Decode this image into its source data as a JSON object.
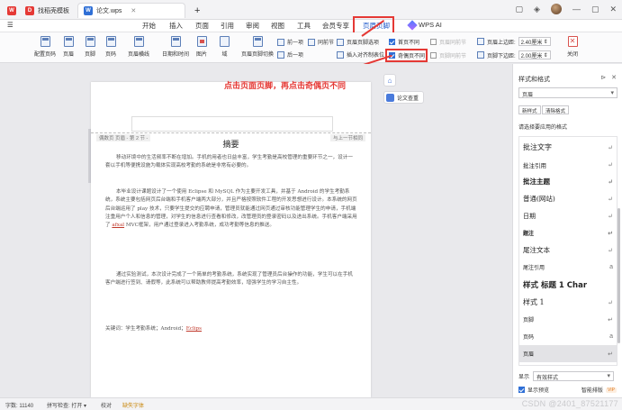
{
  "tabs": [
    {
      "label": "",
      "icon": "wps-logo-icon"
    },
    {
      "label": "找稻壳模板",
      "icon": "docer-icon"
    },
    {
      "label": "论文.wps",
      "icon": "wps-doc-icon"
    }
  ],
  "titlebar_add": "+",
  "titlebar_right": [
    "▢",
    "◈",
    "—",
    "▢",
    "✕"
  ],
  "menu": [
    "☰",
    "开始",
    "插入",
    "页面",
    "引用",
    "审阅",
    "视图",
    "工具",
    "会员专享",
    "页眉页脚",
    "WPS AI"
  ],
  "ribbon": {
    "buttons": [
      "配置页码",
      "页眉",
      "页脚",
      "页码",
      "页眉横线",
      "日期和时间",
      "图片",
      "域",
      "页眉页脚切换"
    ],
    "prev": "前一项",
    "next": "后一项",
    "same_as_prev": "同前节",
    "header_options": "页眉页脚选项",
    "insert_align_tab": "插入对齐制表位",
    "first_page_diff": "首页不同",
    "odd_even_diff": "奇偶页不同",
    "header_same_prev": "页眉同前节",
    "footer_same_prev": "页脚同前节",
    "header_top_label": "页眉上边距:",
    "header_top_value": "2.40厘米",
    "footer_bottom_label": "页脚下边距:",
    "footer_bottom_value": "2.00厘米",
    "close": "关闭"
  },
  "annotation": "点击页面页脚，再点击奇偶页不同",
  "document": {
    "header_left_tag": "偶数页 页眉 - 第 2 节 -",
    "header_right_tag": "与上一节相同",
    "title": "摘要",
    "paragraphs": [
      "移动环境中的生活频率不断在增加。手机的用者也日益丰富，学生考勤是高校管理的重要环节之一，设计一套以手机等便携设施为载体实现高校考勤的系统是非常有必要的。",
      "本毕业设计课题设计了一个使用 Eclipse 和 MySQL 作为主要开发工具，并基于 Android 的学生考勤系统，系统主要包括网页后台端和手机客户端两大部分，并且严格按照软件工程的开发思想进行设计。本系统的网页后台端运用了 play 技术，只要学生提交的应聘申请，管理员就能通过网页通过审核功能管理学生的申请，手机端注重用户个人和信息的管理，对学生的信息进行查看和修改，改管理员的登录密码以及进出系统。手机客户端采用了",
      "MVC框架，用户通过登录进入考勤系统，成功考勤等信息的推送。",
      "通过实验测试，本次设计完成了一个简单的考勤系统，系统实现了管理员后台操作的功能，学生可以在手机客户端进行签到、请假等，此系统可以帮助教师提高考勤效率，增强学生的学习自主性。"
    ],
    "paragraph2_link": "afxal",
    "keywords_label": "关键词：学生考勤系统；Android；",
    "keywords_link": "Eclips"
  },
  "side_tools": {
    "paper_check": "论文查重"
  },
  "panel": {
    "title": "样式和格式",
    "current_style": "页眉",
    "new_style": "新样式",
    "clear_format": "清除格式",
    "apply_label": "请选择要应用的格式",
    "styles": [
      "批注文字",
      "批注引用",
      "批注主题",
      "普通(网站)",
      "日期",
      "题注",
      "尾注文本",
      "尾注引用",
      "样式 标题 1 Char",
      "样式 1",
      "页脚",
      "页码",
      "页眉",
      "正文"
    ],
    "selected_style": "页眉",
    "show_label": "显示",
    "show_value": "有效样式",
    "preview_label": "显示预览",
    "smart_sort": "智能排版",
    "smart_pill": "VIP"
  },
  "status": {
    "word_count": "字数: 11140",
    "spell": "拼写检查: 打开 ▾",
    "proof": "校对",
    "font_warn": "缺失字体",
    "watermark": "CSDN @2401_87521177"
  }
}
